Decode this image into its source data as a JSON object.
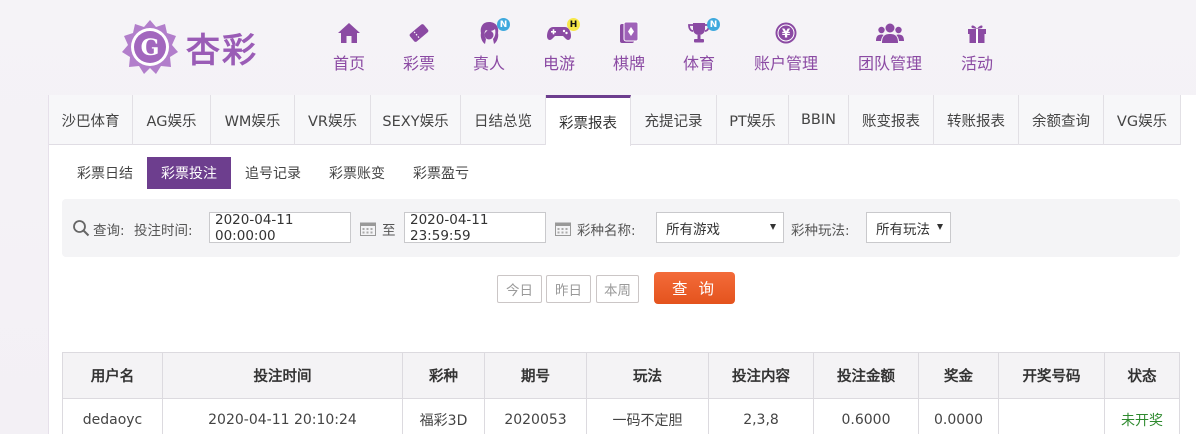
{
  "brand": {
    "name": "杏彩"
  },
  "nav": [
    {
      "label": "首页",
      "icon": "home-icon",
      "badge": ""
    },
    {
      "label": "彩票",
      "icon": "lottery-ticket-icon",
      "badge": ""
    },
    {
      "label": "真人",
      "icon": "live-dealer-icon",
      "badge": "N"
    },
    {
      "label": "电游",
      "icon": "gamepad-icon",
      "badge": "H"
    },
    {
      "label": "棋牌",
      "icon": "playing-cards-icon",
      "badge": ""
    },
    {
      "label": "体育",
      "icon": "trophy-icon",
      "badge": "N"
    },
    {
      "label": "账户管理",
      "icon": "yen-coin-icon",
      "badge": ""
    },
    {
      "label": "团队管理",
      "icon": "team-users-icon",
      "badge": ""
    },
    {
      "label": "活动",
      "icon": "gift-icon",
      "badge": ""
    }
  ],
  "tabs": [
    "沙巴体育",
    "AG娱乐",
    "WM娱乐",
    "VR娱乐",
    "SEXY娱乐",
    "日结总览",
    "彩票报表",
    "充提记录",
    "PT娱乐",
    "BBIN",
    "账变报表",
    "转账报表",
    "余额查询",
    "VG娱乐"
  ],
  "active_tab": "彩票报表",
  "subtabs": [
    "彩票日结",
    "彩票投注",
    "追号记录",
    "彩票账变",
    "彩票盈亏"
  ],
  "active_subtab": "彩票投注",
  "filter": {
    "query_label": "查询:",
    "time_label": "投注时间:",
    "start_time": "2020-04-11 00:00:00",
    "to_label": "至",
    "end_time": "2020-04-11 23:59:59",
    "game_label": "彩种名称:",
    "game_value": "所有游戏",
    "play_label": "彩种玩法:",
    "play_value": "所有玩法"
  },
  "quick_buttons": [
    "今日",
    "昨日",
    "本周"
  ],
  "search_button": "查 询",
  "table": {
    "headers": [
      "用户名",
      "投注时间",
      "彩种",
      "期号",
      "玩法",
      "投注内容",
      "投注金额",
      "奖金",
      "开奖号码",
      "状态"
    ],
    "rows": [
      [
        "dedaoyc",
        "2020-04-11 20:10:24",
        "福彩3D",
        "2020053",
        "一码不定胆",
        "2,3,8",
        "0.6000",
        "0.0000",
        "",
        "未开奖"
      ]
    ]
  },
  "colors": {
    "brand_purple": "#8b4aa3",
    "active_tab_purple": "#6d3e8e",
    "search_orange": "#e9592a",
    "status_green": "#2f8a2f"
  }
}
